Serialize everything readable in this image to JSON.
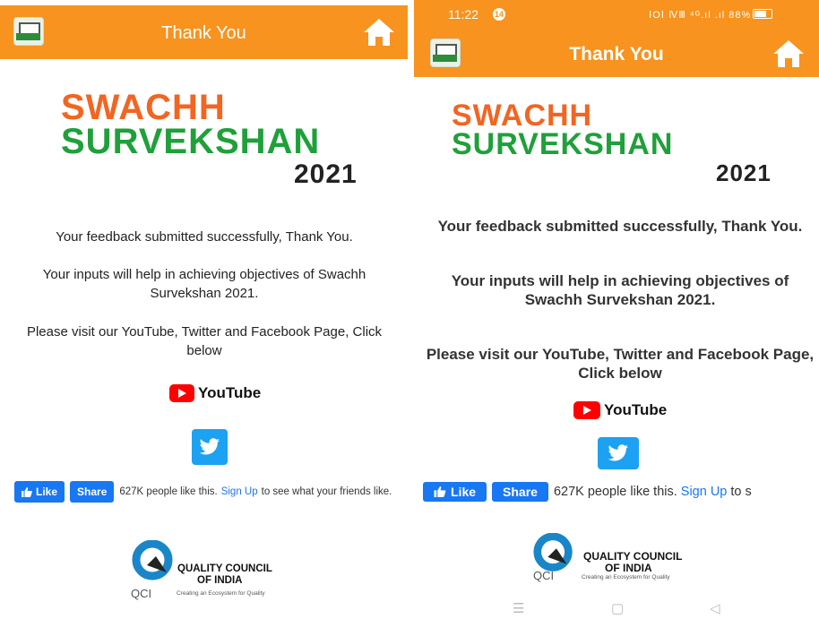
{
  "left": {
    "appbar": {
      "title": "Thank You"
    },
    "logo": {
      "line1": "SWACHH",
      "line2": "SURVEKSHAN",
      "year": "2021"
    },
    "messages": {
      "feedback": "Your feedback submitted successfully, Thank You.",
      "inputs": "Your inputs will help in achieving objectives of Swachh Survekshan 2021.",
      "visit": "Please visit our YouTube, Twitter and Facebook Page, Click below"
    },
    "youtube": {
      "label": "YouTube"
    },
    "facebook": {
      "like": "Like",
      "share": "Share",
      "count_text": "627K people like this.",
      "signup": "Sign Up",
      "suffix": "to see what your friends like."
    },
    "qci": {
      "name": "QUALITY COUNCIL",
      "name2": "OF INDIA",
      "abbr": "QCI",
      "tagline": "Creating an Ecosystem for Quality"
    }
  },
  "right": {
    "status": {
      "time": "11:22",
      "notif": "14",
      "icons": "ⅠOⅠ ⅣⅢ ⁴ᴳ.ıl .ıl 88%"
    },
    "appbar": {
      "title": "Thank You"
    },
    "logo": {
      "line1": "SWACHH",
      "line2": "SURVEKSHAN",
      "year": "2021"
    },
    "messages": {
      "feedback": "Your feedback submitted successfully, Thank You.",
      "inputs": "Your inputs will help in achieving objectives of Swachh Survekshan 2021.",
      "visit": "Please visit our YouTube, Twitter and Facebook Page, Click below"
    },
    "youtube": {
      "label": "YouTube"
    },
    "facebook": {
      "like": "Like",
      "share": "Share",
      "count_text": "627K people like this.",
      "signup": "Sign Up",
      "suffix": "to s"
    },
    "qci": {
      "name": "QUALITY COUNCIL",
      "name2": "OF INDIA",
      "abbr": "QCI",
      "tagline": "Creating an Ecosystem for Quality"
    },
    "navbar": {
      "menu": "☰",
      "home": "▢",
      "back": "◁"
    }
  },
  "colors": {
    "appbar": "#f7931e",
    "orange_logo": "#f26522",
    "green_logo": "#1fa03a",
    "facebook": "#1877f2",
    "twitter": "#1da1f2",
    "youtube": "#ff0000"
  },
  "icons": [
    "app-printer-icon",
    "home-icon",
    "youtube-play-icon",
    "twitter-bird-icon",
    "thumbs-up-icon",
    "qci-logo-icon"
  ]
}
